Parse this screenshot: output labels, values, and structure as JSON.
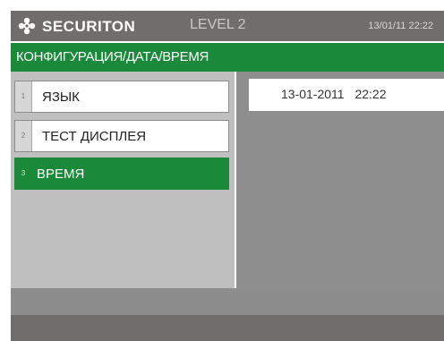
{
  "header": {
    "brand": "SECURITON",
    "level": "LEVEL 2",
    "datetime": "13/01/11 22:22",
    "logo_icon": "gear-flower-icon"
  },
  "breadcrumb": {
    "path": "КОНФИГУРАЦИЯ/ДАТА/ВРЕМЯ"
  },
  "menu": {
    "items": [
      {
        "number": "1",
        "label": "ЯЗЫК",
        "selected": false
      },
      {
        "number": "2",
        "label": "ТЕСТ ДИСПЛЕЯ",
        "selected": false
      },
      {
        "number": "3",
        "label": "ВРЕМЯ",
        "selected": true
      }
    ]
  },
  "detail": {
    "value": "13-01-2011 22:22"
  },
  "colors": {
    "accent_green": "#1a8a3a",
    "header_gray": "#6f6e6c",
    "panel_light": "#bfbfbf",
    "panel_dark": "#8e8e8e"
  }
}
